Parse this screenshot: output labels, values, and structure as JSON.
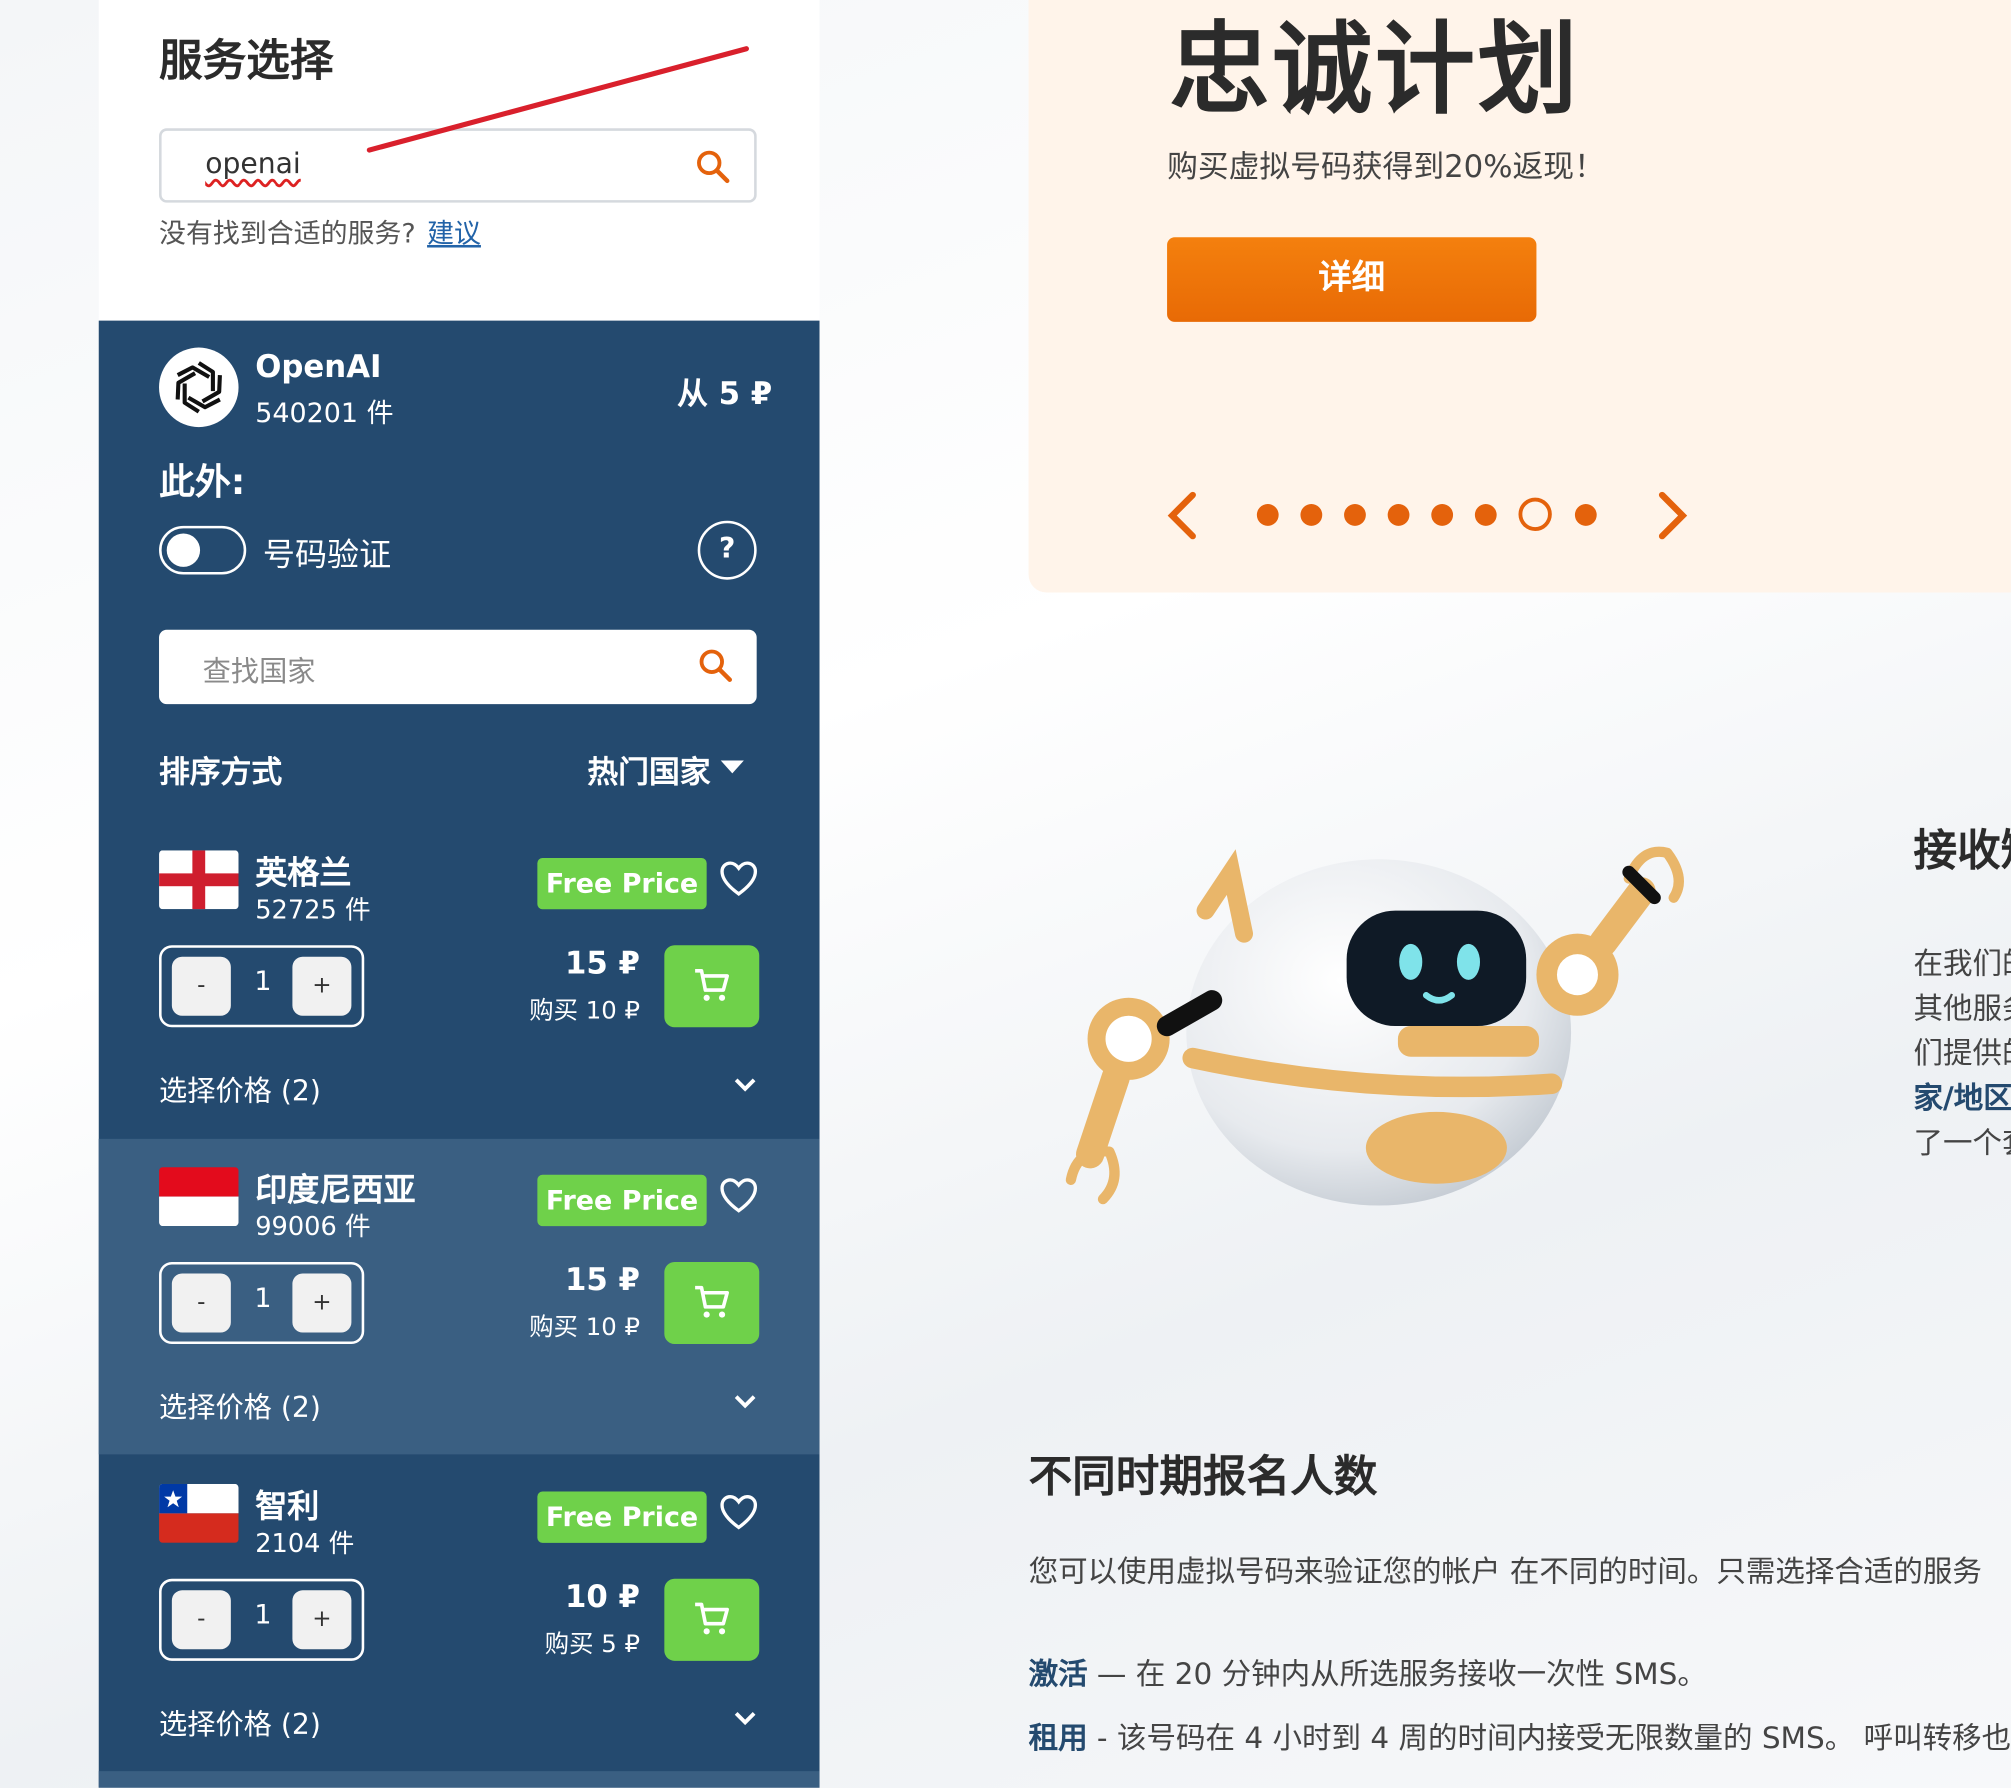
{
  "service_select": {
    "title": "服务选择",
    "search_value": "openai",
    "not_found_text": "没有找到合适的服务?",
    "suggest_link": "建议"
  },
  "service": {
    "name": "OpenAI",
    "count": "540201 件",
    "price_from": "从 5 ₽",
    "extra_title": "此外:",
    "toggle_label": "号码验证",
    "toggle_on": false,
    "help_label": "?",
    "country_search_placeholder": "查找国家",
    "sort_label": "排序方式",
    "sort_value": "热门国家"
  },
  "countries": [
    {
      "name": "英格兰",
      "count": "52725 件",
      "badge": "Free Price",
      "qty": "1",
      "price": "15 ₽",
      "buy": "购买 10 ₽",
      "choose": "选择价格 (2)"
    },
    {
      "name": "印度尼西亚",
      "count": "99006 件",
      "badge": "Free Price",
      "qty": "1",
      "price": "15 ₽",
      "buy": "购买 10 ₽",
      "choose": "选择价格 (2)"
    },
    {
      "name": "智利",
      "count": "2104 件",
      "badge": "Free Price",
      "qty": "1",
      "price": "10 ₽",
      "buy": "购买 5 ₽",
      "choose": "选择价格 (2)"
    }
  ],
  "qty_controls": {
    "minus": "-",
    "plus": "+"
  },
  "promo": {
    "title": "忠诚计划",
    "subtitle": "购买虚拟号码获得到20%返现！",
    "button": "详细",
    "dots_count": 8,
    "active_dot": 7
  },
  "receive": {
    "title": "接收短",
    "lines": [
      "在我们的",
      "其他服务",
      "们提供的",
      "家/地区",
      "了一个套"
    ]
  },
  "period": {
    "title": "不同时期报名人数",
    "desc": "您可以使用虚拟号码来验证您的帐户 在不同的时间。只需选择合适的服务",
    "activation_label": "激活",
    "activation_text": " — 在 20 分钟内从所选服务接收一次性 SMS。",
    "rent_label": "租用",
    "rent_text": " - 该号码在 4 小时到 4 周的时间内接受无限数量的 SMS。 呼叫转移也"
  },
  "colors": {
    "panel": "#244a6f",
    "panel_alt": "#3a5f82",
    "accent_orange": "#e4620c",
    "green": "#6fd14a",
    "promo_bg": "#fff4ea"
  }
}
